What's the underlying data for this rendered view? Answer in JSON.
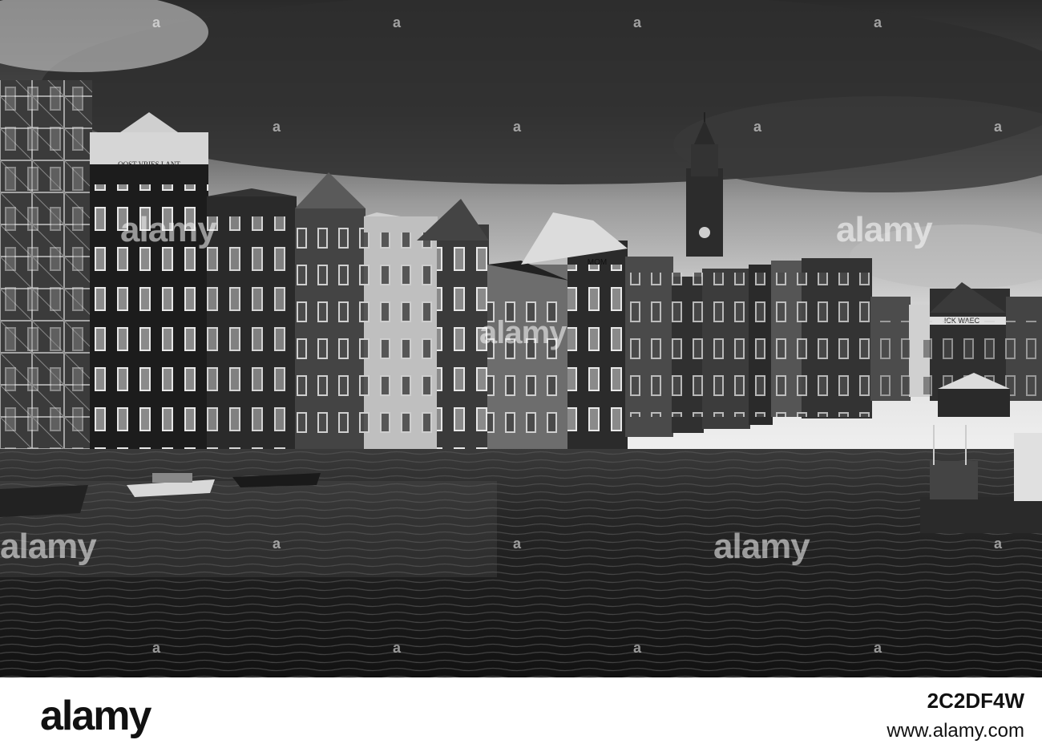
{
  "photo": {
    "description_tags": [
      "sky-clouds",
      "canal-houses",
      "church-tower",
      "canal-water",
      "boats"
    ],
    "building_signs": {
      "facade_inscription": "OOST VRIES LANT",
      "mom_sign": "MOM",
      "waag_sign": "ICK WAEC"
    }
  },
  "watermark": {
    "text": "alamy",
    "dot": "a"
  },
  "footer": {
    "logo": "alamy",
    "image_id": "2C2DF4W",
    "site": "www.alamy.com"
  }
}
